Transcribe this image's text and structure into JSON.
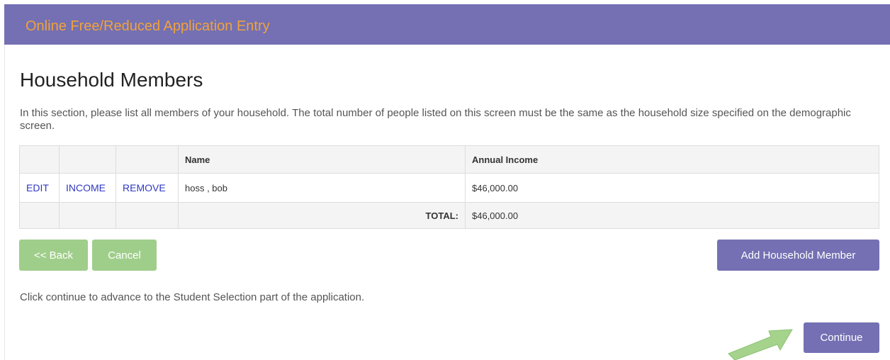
{
  "header": {
    "title": "Online Free/Reduced Application Entry"
  },
  "main": {
    "page_title": "Household Members",
    "intro": "In this section, please list all members of your household. The total number of people listed on this screen must be the same as the household size specified on the demographic screen.",
    "table": {
      "columns": [
        "",
        "",
        "",
        "Name",
        "Annual Income"
      ],
      "rows": [
        {
          "edit_label": "EDIT",
          "income_label": "INCOME",
          "remove_label": "REMOVE",
          "name": "hoss , bob",
          "annual_income": "$46,000.00"
        }
      ],
      "total_label": "TOTAL:",
      "total_value": "$46,000.00"
    },
    "buttons": {
      "back": "<< Back",
      "cancel": "Cancel",
      "add_member": "Add Household Member",
      "continue": "Continue"
    },
    "continue_note": "Click continue to advance to the Student Selection part of the application."
  },
  "colors": {
    "header_bg": "#7470b3",
    "header_title": "#f0a23c",
    "primary_button": "#7470b3",
    "secondary_button": "#9fce8a",
    "link": "#2f39c0",
    "arrow": "#a5d38c"
  }
}
